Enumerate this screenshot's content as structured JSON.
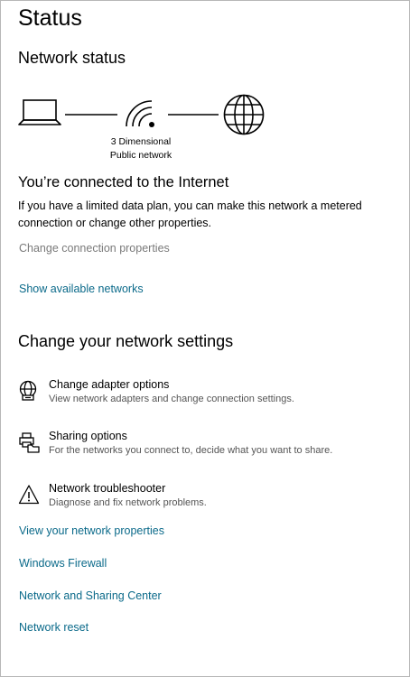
{
  "page": {
    "title": "Status"
  },
  "network_status": {
    "heading": "Network status",
    "network_name": "3 Dimensional",
    "network_type": "Public network",
    "connected_title": "You’re connected to the Internet",
    "description": "If you have a limited data plan, you can make this network a metered connection or change other properties.",
    "change_props_link": "Change connection properties",
    "show_networks_link": "Show available networks"
  },
  "change_settings": {
    "heading": "Change your network settings",
    "options": [
      {
        "title": "Change adapter options",
        "subtitle": "View network adapters and change connection settings.",
        "icon": "adapter-globe-icon"
      },
      {
        "title": "Sharing options",
        "subtitle": "For the networks you connect to, decide what you want to share.",
        "icon": "sharing-printer-icon"
      },
      {
        "title": "Network troubleshooter",
        "subtitle": "Diagnose and fix network problems.",
        "icon": "warning-icon"
      }
    ]
  },
  "links": [
    "View your network properties",
    "Windows Firewall",
    "Network and Sharing Center",
    "Network reset"
  ],
  "colors": {
    "link": "#0b6a8a",
    "disabled_link": "#7a7a7a",
    "text": "#000000"
  }
}
